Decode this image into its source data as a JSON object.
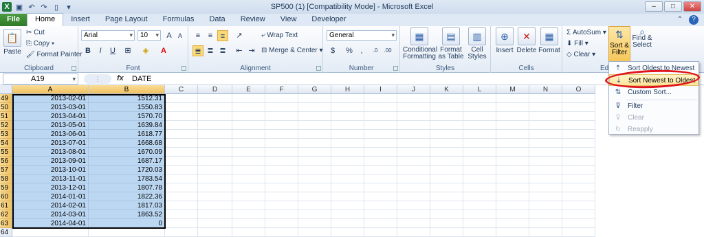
{
  "window": {
    "title": "SP500 (1)  [Compatibility Mode] - Microsoft Excel"
  },
  "tabs": [
    "File",
    "Home",
    "Insert",
    "Page Layout",
    "Formulas",
    "Data",
    "Review",
    "View",
    "Developer"
  ],
  "ribbon": {
    "clipboard": {
      "paste": "Paste",
      "cut": "Cut",
      "copy": "Copy",
      "format_painter": "Format Painter",
      "label": "Clipboard"
    },
    "font": {
      "name": "Arial",
      "size": "10",
      "bold": "B",
      "italic": "I",
      "underline": "U",
      "label": "Font"
    },
    "alignment": {
      "wrap": "Wrap Text",
      "merge": "Merge & Center",
      "label": "Alignment"
    },
    "number": {
      "format": "General",
      "label": "Number"
    },
    "styles": {
      "cond": "Conditional Formatting",
      "table": "Format as Table",
      "cell": "Cell Styles",
      "label": "Styles"
    },
    "cells": {
      "insert": "Insert",
      "delete": "Delete",
      "format": "Format",
      "label": "Cells"
    },
    "editing": {
      "autosum": "AutoSum",
      "fill": "Fill",
      "clear": "Clear",
      "sort": "Sort & Filter",
      "find": "Find & Select",
      "label": "Edi"
    }
  },
  "formula_bar": {
    "name_box": "A19",
    "fx": "fx",
    "content": "DATE"
  },
  "columns": [
    "A",
    "B",
    "C",
    "D",
    "E",
    "F",
    "G",
    "H",
    "I",
    "J",
    "K",
    "L",
    "M",
    "N",
    "O"
  ],
  "rows": [
    {
      "n": "49",
      "a": "2013-02-01",
      "b": "1512.31"
    },
    {
      "n": "50",
      "a": "2013-03-01",
      "b": "1550.83"
    },
    {
      "n": "51",
      "a": "2013-04-01",
      "b": "1570.70"
    },
    {
      "n": "52",
      "a": "2013-05-01",
      "b": "1639.84"
    },
    {
      "n": "53",
      "a": "2013-06-01",
      "b": "1618.77"
    },
    {
      "n": "54",
      "a": "2013-07-01",
      "b": "1668.68"
    },
    {
      "n": "55",
      "a": "2013-08-01",
      "b": "1670.09"
    },
    {
      "n": "56",
      "a": "2013-09-01",
      "b": "1687.17"
    },
    {
      "n": "57",
      "a": "2013-10-01",
      "b": "1720.03"
    },
    {
      "n": "58",
      "a": "2013-11-01",
      "b": "1783.54"
    },
    {
      "n": "59",
      "a": "2013-12-01",
      "b": "1807.78"
    },
    {
      "n": "60",
      "a": "2014-01-01",
      "b": "1822.36"
    },
    {
      "n": "61",
      "a": "2014-02-01",
      "b": "1817.03"
    },
    {
      "n": "62",
      "a": "2014-03-01",
      "b": "1863.52"
    },
    {
      "n": "63",
      "a": "2014-04-01",
      "b": "0"
    },
    {
      "n": "64",
      "a": "",
      "b": ""
    }
  ],
  "menu": {
    "items": [
      "Sort Oldest to Newest",
      "Sort Newest to Oldest",
      "Custom Sort...",
      "Filter",
      "Clear",
      "Reapply"
    ]
  },
  "colors": {
    "accent": "#f6c75a",
    "highlight": "#e0141b",
    "selection": "#bcd7f2"
  }
}
